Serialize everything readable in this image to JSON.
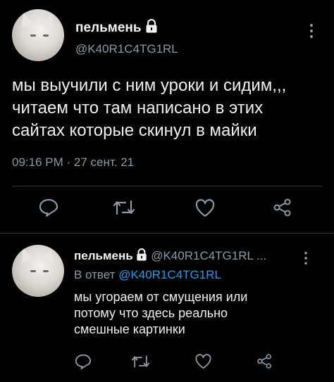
{
  "main_tweet": {
    "author_name": "пельмень",
    "handle": "@K40R1C4TG1RL",
    "text_lines": [
      "мы выучили с ним уроки и сидим,,,",
      "читаем что там написано в этих",
      "сайтах которые скинул в майки"
    ],
    "time": "09:16 PM",
    "separator": "·",
    "date": "27 сент. 21"
  },
  "reply_tweet": {
    "author_name": "пельмень",
    "handle": "@K40R1C4TG1RL ...",
    "reply_prefix": "В ответ",
    "reply_to": "@K40R1C4TG1RL",
    "text_lines": [
      "мы угораем от смущения или",
      "потому что здесь реально",
      "смешные картинки"
    ]
  },
  "icons": [
    "lock-icon",
    "more-vertical-icon",
    "reply-icon",
    "retweet-icon",
    "like-icon",
    "share-icon"
  ],
  "colors": {
    "background": "#000000",
    "text": "#e7e9ea",
    "muted": "#8b98a5",
    "link": "#1d9bf0",
    "divider": "#2f3336"
  }
}
